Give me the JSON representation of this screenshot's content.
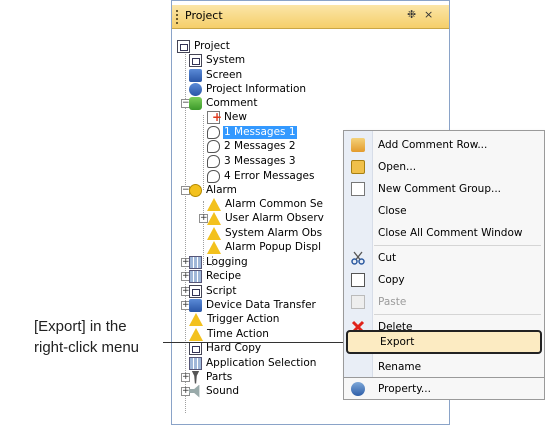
{
  "panel": {
    "title": "Project",
    "pin_label": "❉",
    "close_label": "×"
  },
  "tree": [
    {
      "label": "Project",
      "icon": "project-icon"
    },
    {
      "label": "System",
      "icon": "system-icon"
    },
    {
      "label": "Screen",
      "icon": "screen-icon"
    },
    {
      "label": "Project Information",
      "icon": "info-icon"
    },
    {
      "label": "Comment",
      "icon": "comment-icon"
    },
    {
      "label": "New",
      "icon": "new-comment-icon"
    },
    {
      "label": "1 Messages 1",
      "icon": "message-icon",
      "selected": true
    },
    {
      "label": "2 Messages 2",
      "icon": "message-icon"
    },
    {
      "label": "3 Messages 3",
      "icon": "message-icon"
    },
    {
      "label": "4 Error Messages",
      "icon": "message-icon"
    },
    {
      "label": "Alarm",
      "icon": "alarm-icon"
    },
    {
      "label": "Alarm Common Se",
      "icon": "warning-icon"
    },
    {
      "label": "User Alarm Observ",
      "icon": "warning-icon"
    },
    {
      "label": "System Alarm Obs",
      "icon": "warning-icon"
    },
    {
      "label": "Alarm Popup Displ",
      "icon": "warning-icon"
    },
    {
      "label": "Logging",
      "icon": "logging-icon"
    },
    {
      "label": "Recipe",
      "icon": "recipe-icon"
    },
    {
      "label": "Script",
      "icon": "script-icon"
    },
    {
      "label": "Device Data Transfer",
      "icon": "device-transfer-icon"
    },
    {
      "label": "Trigger Action",
      "icon": "trigger-icon"
    },
    {
      "label": "Time Action",
      "icon": "time-action-icon"
    },
    {
      "label": "Hard Copy",
      "icon": "hardcopy-icon"
    },
    {
      "label": "Application Selection",
      "icon": "app-selection-icon"
    },
    {
      "label": "Parts",
      "icon": "parts-icon"
    },
    {
      "label": "Sound",
      "icon": "sound-icon"
    }
  ],
  "context_menu": [
    {
      "label": "Add Comment Row...",
      "icon": "add-row-icon"
    },
    {
      "label": "Open...",
      "icon": "open-icon"
    },
    {
      "label": "New Comment Group...",
      "icon": "new-group-icon"
    },
    {
      "label": "Close",
      "icon": ""
    },
    {
      "label": "Close All Comment Window",
      "icon": ""
    },
    {
      "label": "Cut",
      "icon": "cut-icon"
    },
    {
      "label": "Copy",
      "icon": "copy-icon"
    },
    {
      "label": "Paste",
      "icon": "paste-icon",
      "disabled": true
    },
    {
      "label": "Delete",
      "icon": "delete-icon"
    },
    {
      "label": "Export",
      "icon": "",
      "highlighted": true
    },
    {
      "label": "Rename",
      "icon": ""
    },
    {
      "label": "Property...",
      "icon": "property-icon"
    }
  ],
  "callout": {
    "line1": "[Export] in the",
    "line2": "right-click menu"
  }
}
